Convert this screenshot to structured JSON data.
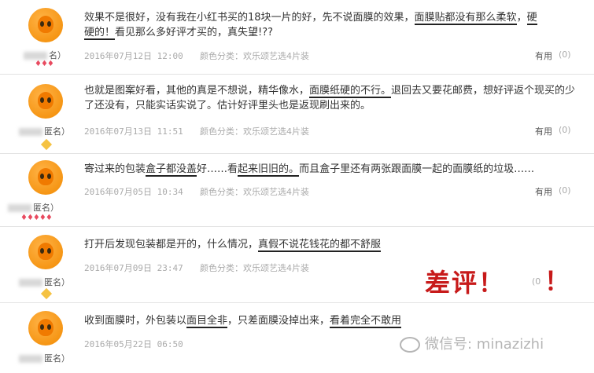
{
  "reviews": [
    {
      "user": "名）",
      "text_parts": [
        "效果不是很好，没有我在小红书买的18块一片的好，先不说面膜的效果，",
        "面膜贴都没有那么柔软",
        "，",
        "硬",
        "硬的！",
        "看见那么多好评才买的，真失望!??"
      ],
      "date": "2016年07月12日 12:00",
      "variant": "颜色分类：欢乐颂艺选4片装",
      "useful": "有用",
      "count": "(0)",
      "badge": "♦♦♦"
    },
    {
      "user": "匿名）",
      "text_parts": [
        "也就是图案好看，其他的真是不想说，精华像水，",
        "面膜纸硬的不行。",
        "退回去又要花邮费，想好评返个现买的少了还没有，只能实话实说了。估计好评里头也是返现刷出来的。"
      ],
      "date": "2016年07月13日 11:51",
      "variant": "颜色分类：欢乐颂艺选4片装",
      "useful": "有用",
      "count": "(0)"
    },
    {
      "user": "匿名）",
      "text_parts": [
        "寄过来的包装",
        "盒子都没盖",
        "好……看",
        "起来旧旧的。",
        "而且盒子里还有两张跟面膜一起的面膜纸的垃圾……"
      ],
      "date": "2016年07月05日 10:34",
      "variant": "颜色分类：欢乐颂艺选4片装",
      "useful": "有用",
      "count": "(0)",
      "badge": "♦♦♦♦♦"
    },
    {
      "user": "匿名）",
      "text_parts": [
        "打开后发现包装都是开的，什么情况，",
        "真假不说花钱花的都不舒服"
      ],
      "date": "2016年07月09日 23:47",
      "variant": "颜色分类：欢乐颂艺选4片装",
      "useful": "",
      "count": ""
    },
    {
      "user": "匿名）",
      "text_parts": [
        "收到面膜时，外包装以",
        "面目全非",
        "，只差面膜没掉出来，",
        "看着完全不敢用"
      ],
      "date": "2016年05月22日 06:50",
      "variant": "",
      "useful": "",
      "count": ""
    }
  ],
  "stamp": {
    "text": "差评！",
    "mark": "！",
    "count": "(0"
  },
  "watermark": "微信号: minazizhi",
  "colors": {
    "stamp": "#c71a1a",
    "badge": "#e84a5f",
    "avatar": "#f28a00"
  }
}
